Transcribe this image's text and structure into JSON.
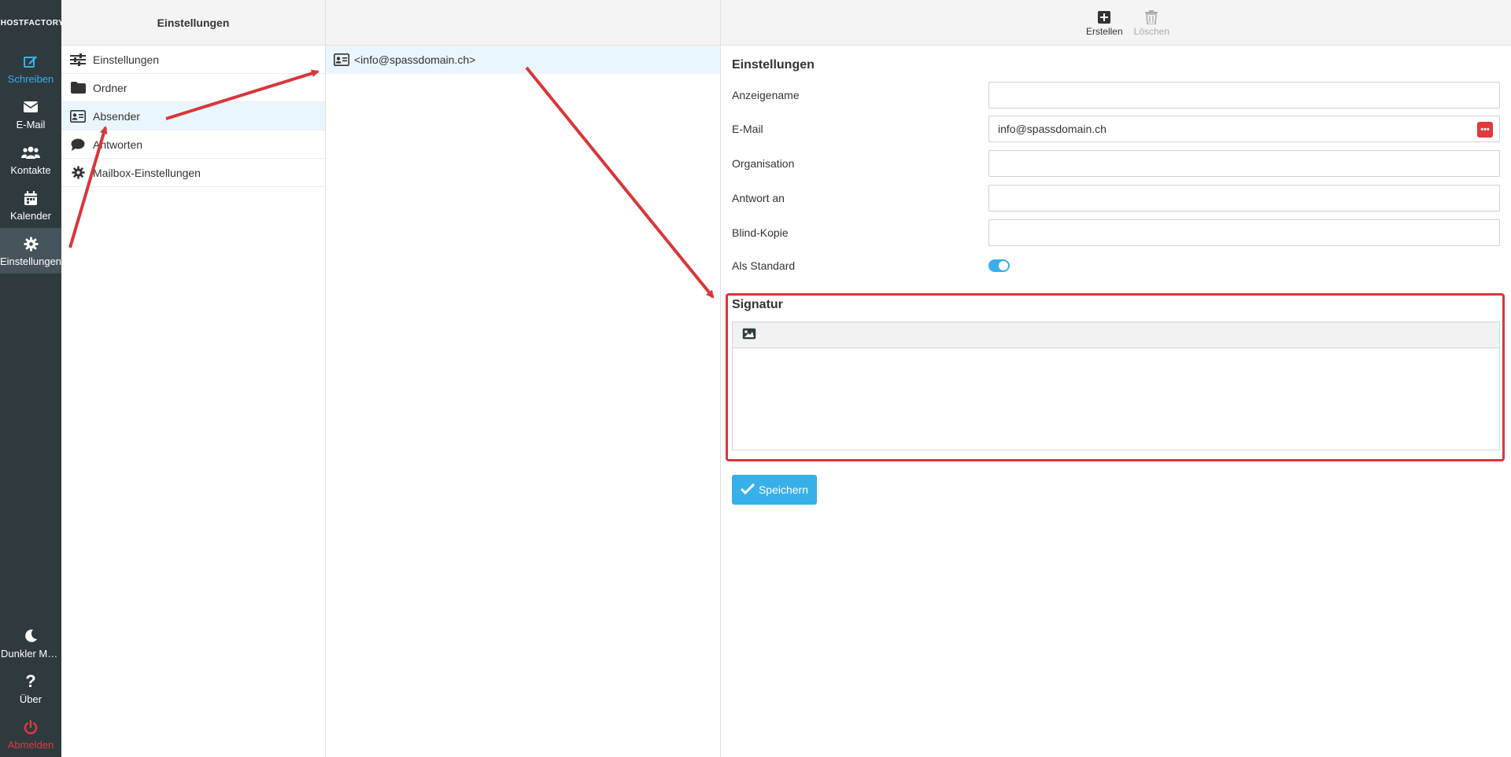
{
  "app": {
    "logo_text": "HOSTFACTORY"
  },
  "nav": {
    "items": [
      {
        "label": "Schreiben",
        "icon": "edit-icon"
      },
      {
        "label": "E-Mail",
        "icon": "envelope-icon"
      },
      {
        "label": "Kontakte",
        "icon": "users-icon"
      },
      {
        "label": "Kalender",
        "icon": "calendar-icon"
      },
      {
        "label": "Einstellungen",
        "icon": "gear-icon"
      }
    ],
    "bottom": [
      {
        "label": "Dunkler Mo...",
        "icon": "moon-icon"
      },
      {
        "label": "Über",
        "icon": "question-icon"
      },
      {
        "label": "Abmelden",
        "icon": "power-icon"
      }
    ]
  },
  "settings_panel": {
    "title": "Einstellungen",
    "items": [
      {
        "label": "Einstellungen",
        "icon": "sliders-icon"
      },
      {
        "label": "Ordner",
        "icon": "folder-icon"
      },
      {
        "label": "Absender",
        "icon": "id-card-icon"
      },
      {
        "label": "Antworten",
        "icon": "comment-icon"
      },
      {
        "label": "Mailbox-Einstellungen",
        "icon": "gear-icon"
      }
    ]
  },
  "identities": {
    "items": [
      {
        "label": "<info@spassdomain.ch>",
        "icon": "id-card-icon"
      }
    ]
  },
  "toolbar": {
    "create_label": "Erstellen",
    "delete_label": "Löschen"
  },
  "form": {
    "title": "Einstellungen",
    "fields": {
      "display_name": {
        "label": "Anzeigename",
        "value": ""
      },
      "email": {
        "label": "E-Mail",
        "value": "info@spassdomain.ch"
      },
      "organisation": {
        "label": "Organisation",
        "value": ""
      },
      "reply_to": {
        "label": "Antwort an",
        "value": ""
      },
      "bcc": {
        "label": "Blind-Kopie",
        "value": ""
      },
      "default": {
        "label": "Als Standard",
        "checked": true
      }
    },
    "signature": {
      "title": "Signatur"
    },
    "save_label": "Speichern"
  },
  "colors": {
    "accent": "#37b0e9",
    "sidebar": "#2f3a3f",
    "annotation": "#d9363b"
  }
}
